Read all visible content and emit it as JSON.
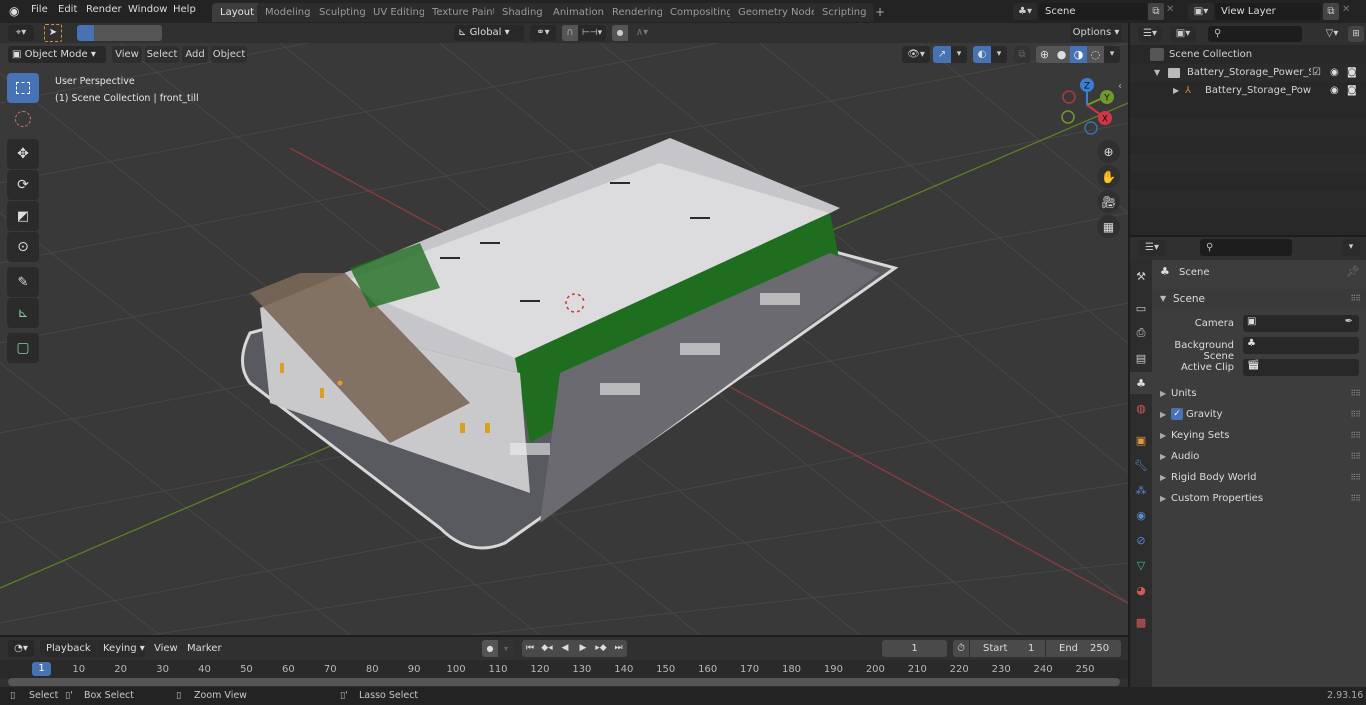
{
  "app": {
    "name": "Blender",
    "version": "2.93.16"
  },
  "topbar": {
    "menus": [
      "File",
      "Edit",
      "Render",
      "Window",
      "Help"
    ],
    "workspaces": [
      "Layout",
      "Modeling",
      "Sculpting",
      "UV Editing",
      "Texture Paint",
      "Shading",
      "Animation",
      "Rendering",
      "Compositing",
      "Geometry Nodes",
      "Scripting"
    ],
    "active_workspace": "Layout",
    "add_workspace": "+",
    "scene_field": "Scene",
    "view_layer_field": "View Layer"
  },
  "viewport": {
    "mode": "Object Mode",
    "menus": [
      "View",
      "Select",
      "Add",
      "Object"
    ],
    "transform_orientation": "Global",
    "options_label": "Options",
    "overlay_title": "User Perspective",
    "overlay_subtitle": "(1) Scene Collection | front_till",
    "gizmo_axes": {
      "x": "X",
      "y": "Y",
      "z": "Z"
    },
    "tools": [
      "select-box",
      "cursor",
      "move",
      "rotate",
      "scale",
      "transform",
      "annotate",
      "measure",
      "add-cube"
    ],
    "nav_buttons": [
      "zoom",
      "pan",
      "camera",
      "perspective-toggle"
    ],
    "colors": {
      "x_axis": "#a83a44",
      "y_axis": "#6f9a2a",
      "active_tool": "#4772b3",
      "building_green": "#1e6b1e",
      "roof_brown": "#7a6858"
    }
  },
  "outliner": {
    "search_placeholder": "",
    "items": [
      {
        "label": "Scene Collection",
        "level": 0,
        "icon": "collection-icon"
      },
      {
        "label": "Battery_Storage_Power_Stati",
        "level": 1,
        "icon": "collection-icon",
        "checked": true,
        "visible": true,
        "renderable": true
      },
      {
        "label": "Battery_Storage_Power_",
        "level": 2,
        "icon": "empty-icon",
        "visible": true,
        "renderable": true
      }
    ]
  },
  "properties": {
    "header_title": "Scene",
    "section_title": "Scene",
    "fields": [
      {
        "label": "Camera",
        "value": ""
      },
      {
        "label": "Background Scene",
        "value": ""
      },
      {
        "label": "Active Clip",
        "value": ""
      }
    ],
    "panels": [
      {
        "label": "Units",
        "checkbox": false
      },
      {
        "label": "Gravity",
        "checkbox": true,
        "checked": true
      },
      {
        "label": "Keying Sets",
        "checkbox": false
      },
      {
        "label": "Audio",
        "checkbox": false
      },
      {
        "label": "Rigid Body World",
        "checkbox": false
      },
      {
        "label": "Custom Properties",
        "checkbox": false
      }
    ],
    "tabs": [
      "tool",
      "render",
      "output",
      "view-layer",
      "scene",
      "world",
      "object",
      "modifiers",
      "particles",
      "physics",
      "constraints",
      "data",
      "material",
      "texture"
    ]
  },
  "timeline": {
    "menus": [
      "Playback",
      "Keying",
      "View",
      "Marker"
    ],
    "current_frame": "1",
    "start_label": "Start",
    "start_value": "1",
    "end_label": "End",
    "end_value": "250",
    "ticks": [
      "1",
      "10",
      "20",
      "30",
      "40",
      "50",
      "60",
      "70",
      "80",
      "90",
      "100",
      "110",
      "120",
      "130",
      "140",
      "150",
      "160",
      "170",
      "180",
      "190",
      "200",
      "210",
      "220",
      "230",
      "240",
      "250"
    ]
  },
  "statusbar": {
    "items": [
      "Select",
      "Box Select",
      "Zoom View",
      "Lasso Select"
    ],
    "version": "2.93.16"
  }
}
